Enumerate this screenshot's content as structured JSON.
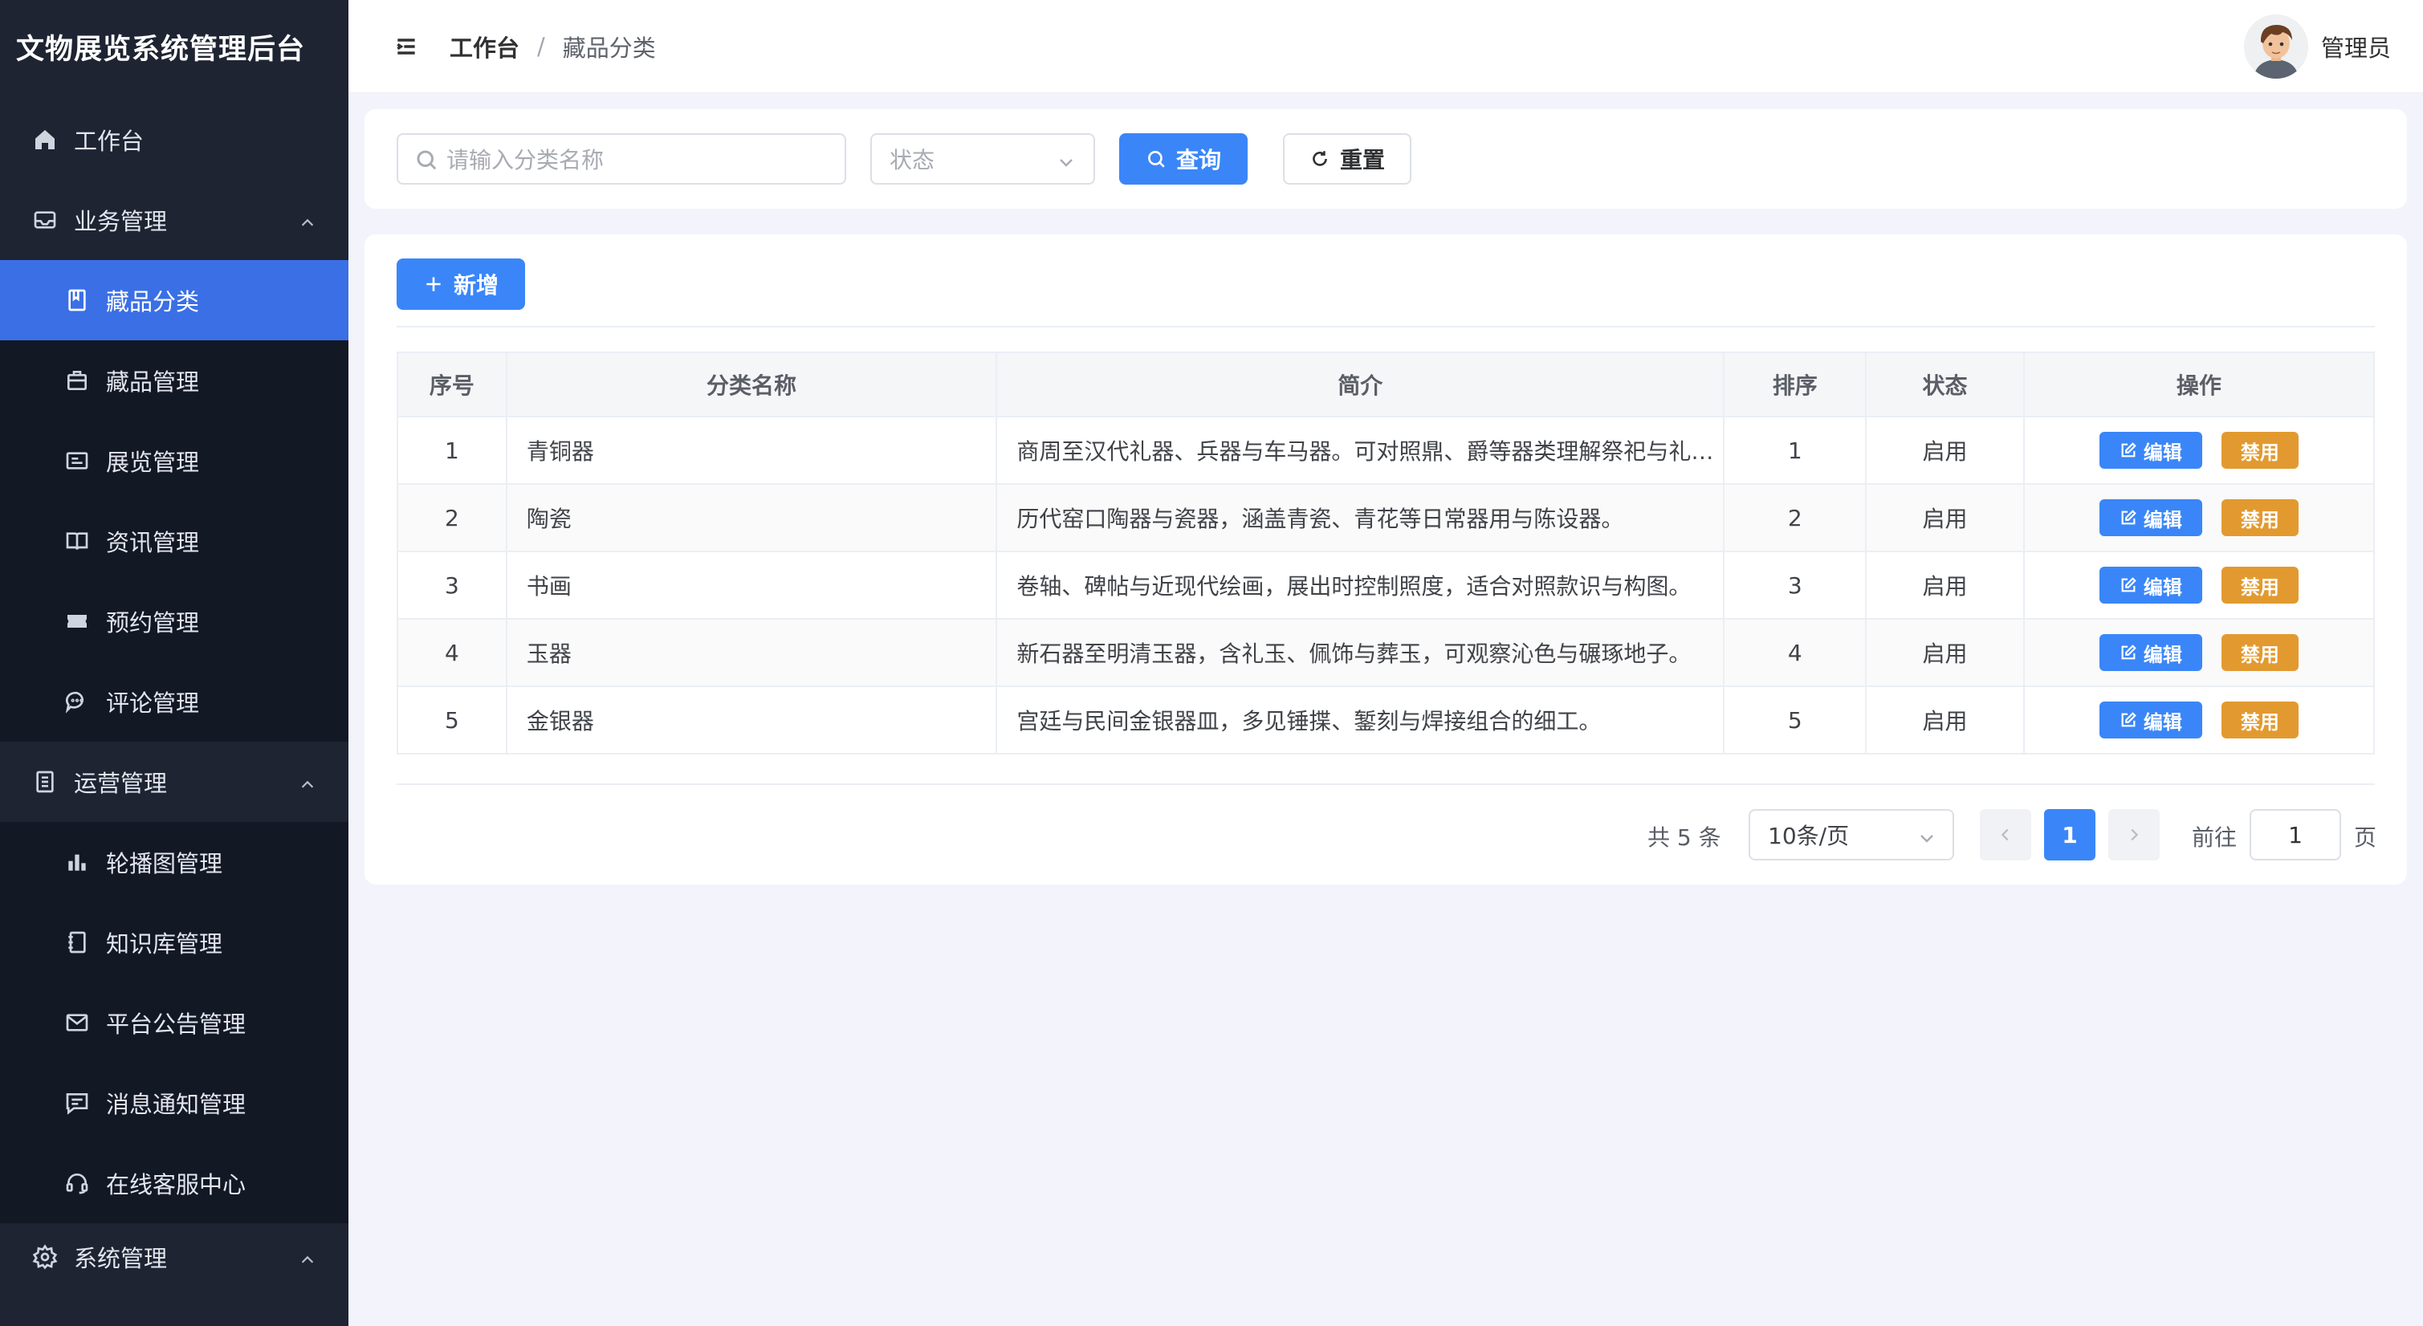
{
  "app": {
    "title": "文物展览系统管理后台"
  },
  "sidebar": {
    "items": [
      {
        "label": "工作台",
        "icon": "home-icon"
      },
      {
        "label": "业务管理",
        "icon": "inbox-icon",
        "expanded": true
      },
      {
        "label": "藏品分类",
        "icon": "book-icon",
        "active": true
      },
      {
        "label": "藏品管理",
        "icon": "box-icon"
      },
      {
        "label": "展览管理",
        "icon": "card-icon"
      },
      {
        "label": "资讯管理",
        "icon": "open-book-icon"
      },
      {
        "label": "预约管理",
        "icon": "ticket-icon"
      },
      {
        "label": "评论管理",
        "icon": "comment-icon"
      },
      {
        "label": "运营管理",
        "icon": "list-icon",
        "expanded": true
      },
      {
        "label": "轮播图管理",
        "icon": "bar-chart-icon"
      },
      {
        "label": "知识库管理",
        "icon": "notebook-icon"
      },
      {
        "label": "平台公告管理",
        "icon": "mail-icon"
      },
      {
        "label": "消息通知管理",
        "icon": "message-icon"
      },
      {
        "label": "在线客服中心",
        "icon": "headset-icon"
      },
      {
        "label": "系统管理",
        "icon": "gear-icon",
        "expanded": true
      }
    ]
  },
  "header": {
    "breadcrumb": [
      "工作台",
      "藏品分类"
    ],
    "separator": "/",
    "user_name": "管理员"
  },
  "search": {
    "name_placeholder": "请输入分类名称",
    "status_placeholder": "状态",
    "query_label": "查询",
    "reset_label": "重置"
  },
  "toolbar": {
    "add_label": "新增"
  },
  "table": {
    "columns": [
      "序号",
      "分类名称",
      "简介",
      "排序",
      "状态",
      "操作"
    ],
    "rows": [
      {
        "index": "1",
        "name": "青铜器",
        "desc": "商周至汉代礼器、兵器与车马器。可对照鼎、爵等器类理解祭祀与礼制。",
        "sort": "1",
        "status": "启用"
      },
      {
        "index": "2",
        "name": "陶瓷",
        "desc": "历代窑口陶器与瓷器，涵盖青瓷、青花等日常器用与陈设器。",
        "sort": "2",
        "status": "启用"
      },
      {
        "index": "3",
        "name": "书画",
        "desc": "卷轴、碑帖与近现代绘画，展出时控制照度，适合对照款识与构图。",
        "sort": "3",
        "status": "启用"
      },
      {
        "index": "4",
        "name": "玉器",
        "desc": "新石器至明清玉器，含礼玉、佩饰与葬玉，可观察沁色与碾琢地子。",
        "sort": "4",
        "status": "启用"
      },
      {
        "index": "5",
        "name": "金银器",
        "desc": "宫廷与民间金银器皿，多见锤揲、錾刻与焊接组合的细工。",
        "sort": "5",
        "status": "启用"
      }
    ],
    "edit_label": "编辑",
    "disable_label": "禁用"
  },
  "pagination": {
    "total_text": "共 5 条",
    "page_size": "10条/页",
    "current_page": "1",
    "goto_label": "前往",
    "goto_value": "1",
    "page_unit": "页"
  },
  "colors": {
    "sidebar_bg": "#1e2432",
    "active_bg": "#3a6fe6",
    "primary": "#3a86f8",
    "warning": "#e29a30"
  }
}
